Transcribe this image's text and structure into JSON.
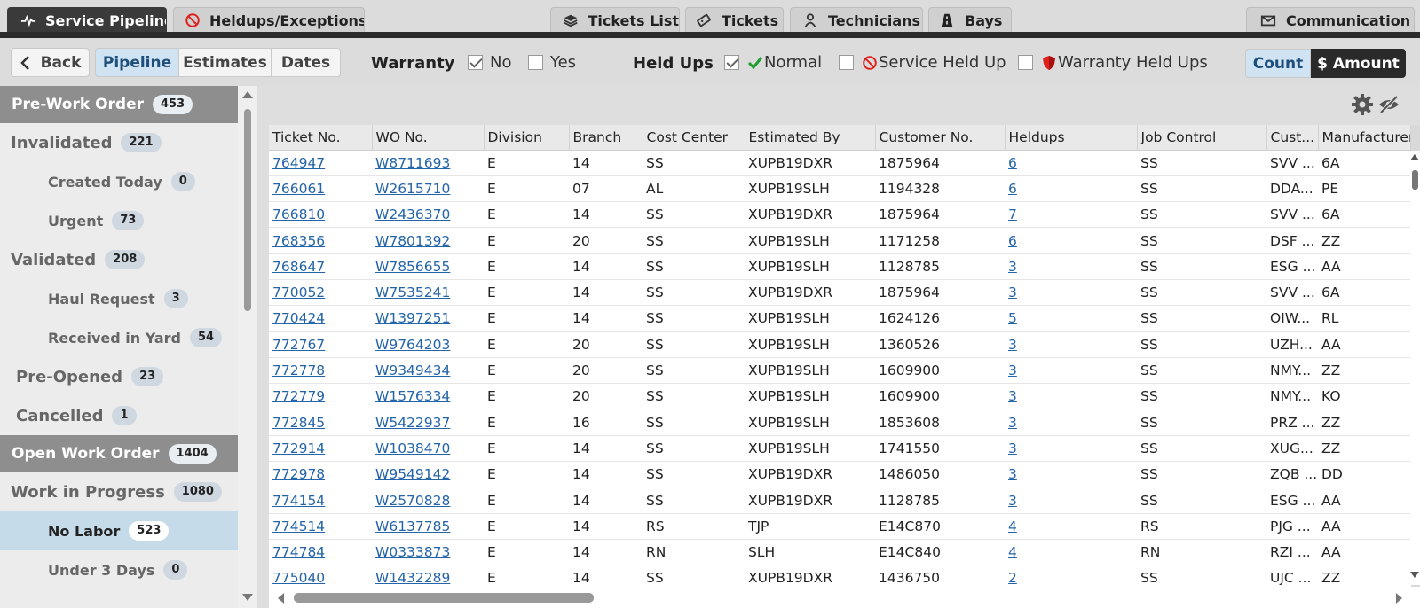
{
  "tabs": {
    "service_pipeline": "Service Pipeline",
    "heldups": "Heldups/Exceptions",
    "tickets_list": "Tickets List",
    "tickets": "Tickets",
    "technicians": "Technicians",
    "bays": "Bays",
    "communication": "Communication"
  },
  "toolbar": {
    "back": "Back",
    "pipeline": "Pipeline",
    "estimates": "Estimates",
    "dates": "Dates",
    "warranty_label": "Warranty",
    "warranty_no": "No",
    "warranty_yes": "Yes",
    "heldups_label": "Held Ups",
    "normal": "Normal",
    "service_held_up": "Service Held Up",
    "warranty_held_ups": "Warranty Held Ups",
    "count": "Count",
    "amount": "$ Amount"
  },
  "sidebar": {
    "pre_work_order": {
      "label": "Pre-Work Order",
      "count": "453"
    },
    "invalidated": {
      "label": "Invalidated",
      "count": "221"
    },
    "created_today": {
      "label": "Created Today",
      "count": "0"
    },
    "urgent": {
      "label": "Urgent",
      "count": "73"
    },
    "validated": {
      "label": "Validated",
      "count": "208"
    },
    "haul_request": {
      "label": "Haul Request",
      "count": "3"
    },
    "received_in_yard": {
      "label": "Received in Yard",
      "count": "54"
    },
    "pre_opened": {
      "label": "Pre-Opened",
      "count": "23"
    },
    "cancelled": {
      "label": "Cancelled",
      "count": "1"
    },
    "open_work_order": {
      "label": "Open Work Order",
      "count": "1404"
    },
    "work_in_progress": {
      "label": "Work in Progress",
      "count": "1080"
    },
    "no_labor": {
      "label": "No Labor",
      "count": "523"
    },
    "under_3_days": {
      "label": "Under 3 Days",
      "count": "0"
    }
  },
  "grid": {
    "columns": [
      "Ticket No.",
      "WO No.",
      "Division",
      "Branch",
      "Cost Center",
      "Estimated By",
      "Customer No.",
      "Heldups",
      "Job Control",
      "Cust...",
      "Manufacturer"
    ],
    "rows": [
      [
        "764947",
        "W8711693",
        "E",
        "14",
        "SS",
        "XUPB19DXR",
        "1875964",
        "6",
        "SS",
        "SVV ...",
        "6A"
      ],
      [
        "766061",
        "W2615710",
        "E",
        "07",
        "AL",
        "XUPB19SLH",
        "1194328",
        "6",
        "SS",
        "DDA...",
        "PE"
      ],
      [
        "766810",
        "W2436370",
        "E",
        "14",
        "SS",
        "XUPB19DXR",
        "1875964",
        "7",
        "SS",
        "SVV ...",
        "6A"
      ],
      [
        "768356",
        "W7801392",
        "E",
        "20",
        "SS",
        "XUPB19SLH",
        "1171258",
        "6",
        "SS",
        "DSF ...",
        "ZZ"
      ],
      [
        "768647",
        "W7856655",
        "E",
        "14",
        "SS",
        "XUPB19SLH",
        "1128785",
        "3",
        "SS",
        "ESG ...",
        "AA"
      ],
      [
        "770052",
        "W7535241",
        "E",
        "14",
        "SS",
        "XUPB19DXR",
        "1875964",
        "3",
        "SS",
        "SVV ...",
        "6A"
      ],
      [
        "770424",
        "W1397251",
        "E",
        "14",
        "SS",
        "XUPB19SLH",
        "1624126",
        "5",
        "SS",
        "OIW...",
        "RL"
      ],
      [
        "772767",
        "W9764203",
        "E",
        "20",
        "SS",
        "XUPB19SLH",
        "1360526",
        "3",
        "SS",
        "UZH...",
        "AA"
      ],
      [
        "772778",
        "W9349434",
        "E",
        "20",
        "SS",
        "XUPB19SLH",
        "1609900",
        "3",
        "SS",
        "NMY...",
        "ZZ"
      ],
      [
        "772779",
        "W1576334",
        "E",
        "20",
        "SS",
        "XUPB19SLH",
        "1609900",
        "3",
        "SS",
        "NMY...",
        "KO"
      ],
      [
        "772845",
        "W5422937",
        "E",
        "16",
        "SS",
        "XUPB19SLH",
        "1853608",
        "3",
        "SS",
        "PRZ ...",
        "ZZ"
      ],
      [
        "772914",
        "W1038470",
        "E",
        "14",
        "SS",
        "XUPB19SLH",
        "1741550",
        "3",
        "SS",
        "XUG...",
        "ZZ"
      ],
      [
        "772978",
        "W9549142",
        "E",
        "14",
        "SS",
        "XUPB19DXR",
        "1486050",
        "3",
        "SS",
        "ZQB ...",
        "DD"
      ],
      [
        "774154",
        "W2570828",
        "E",
        "14",
        "SS",
        "XUPB19DXR",
        "1128785",
        "3",
        "SS",
        "ESG ...",
        "AA"
      ],
      [
        "774514",
        "W6137785",
        "E",
        "14",
        "RS",
        "TJP",
        "E14C870",
        "4",
        "RS",
        "PJG ...",
        "AA"
      ],
      [
        "774784",
        "W0333873",
        "E",
        "14",
        "RN",
        "SLH",
        "E14C840",
        "4",
        "RN",
        "RZI ...",
        "AA"
      ],
      [
        "775040",
        "W1432289",
        "E",
        "14",
        "SS",
        "XUPB19DXR",
        "1436750",
        "2",
        "SS",
        "UJC ...",
        "ZZ"
      ]
    ]
  }
}
